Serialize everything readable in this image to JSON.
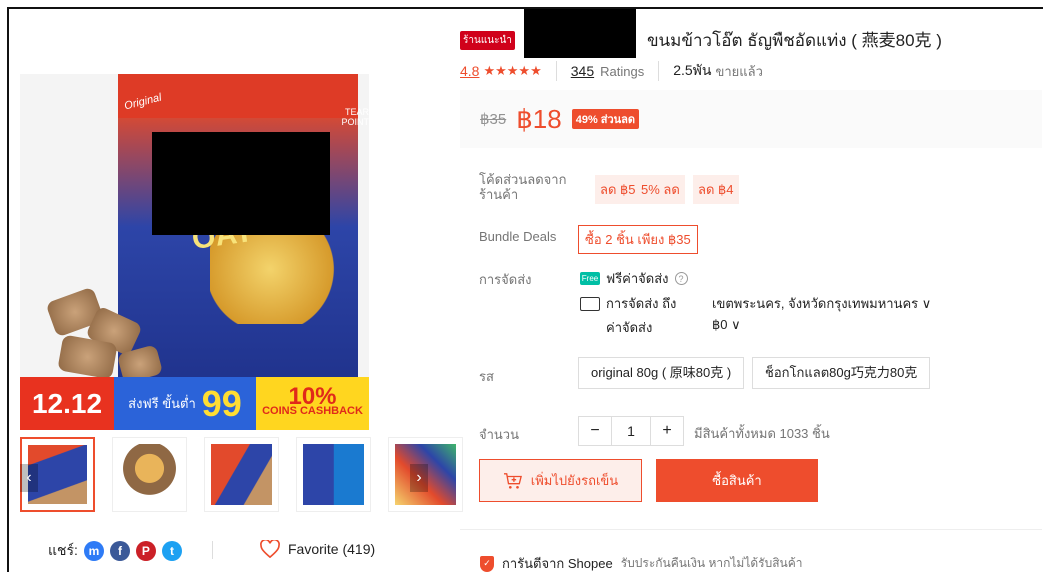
{
  "product": {
    "badge": "ร้านแนะนำ",
    "title": "ขนมข้าวโอ๊ต ธัญพืชอัดแท่ง ( 燕麦80克 )",
    "rating": "4.8",
    "stars": "★★★★★",
    "ratings_count": "345",
    "ratings_label": "Ratings",
    "sold_count": "2.5พัน",
    "sold_label": "ขายแล้ว",
    "old_price": "฿35",
    "price": "฿18",
    "discount": "49% ส่วนลด"
  },
  "image": {
    "pack_label": "Original",
    "tear_text": "TEAR POINT",
    "oat_text": "OAT",
    "promo_date": "12.12",
    "promo_ship": "ส่งฟรี ขั้นต่ำ",
    "promo_ship_amount": "99",
    "promo_cashback_pct": "10%",
    "promo_cashback_label": "COINS CASHBACK"
  },
  "arrows": {
    "prev": "‹",
    "next": "›"
  },
  "coupons": {
    "label": "โค้ดส่วนลดจากร้านค้า",
    "chips": [
      "ลด ฿5",
      "5% ลด",
      "ลด ฿4"
    ]
  },
  "bundle": {
    "label": "Bundle Deals",
    "value": "ซื้อ 2 ชิ้น เพียง ฿35"
  },
  "shipping": {
    "label": "การจัดส่ง",
    "free_badge": "Free",
    "free_text": "ฟรีค่าจัดส่ง",
    "help": "?",
    "to_label": "การจัดส่ง ถึง",
    "to_value": "เขตพระนคร, จังหวัดกรุงเทพมหานคร ∨",
    "fee_label": "ค่าจัดส่ง",
    "fee_value": "฿0 ∨"
  },
  "variants": {
    "label": "รส",
    "options": [
      "original 80g ( 原味80克 )",
      "ช็อกโกแลต80g巧克力80克"
    ]
  },
  "quantity": {
    "label": "จำนวน",
    "minus": "−",
    "value": "1",
    "plus": "+",
    "stock": "มีสินค้าทั้งหมด 1033 ชิ้น"
  },
  "actions": {
    "add_to_cart": "เพิ่มไปยังรถเข็น",
    "buy_now": "ซื้อสินค้า"
  },
  "share": {
    "label": "แชร์:",
    "favorite": "Favorite (419)",
    "icons": {
      "messenger": "m",
      "facebook": "f",
      "pinterest": "P",
      "twitter": "t"
    }
  },
  "guarantee": {
    "title": "การันตีจาก Shopee",
    "text": "รับประกันคืนเงิน หากไม่ได้รับสินค้า"
  },
  "colors": {
    "accent": "#ee4d2d",
    "messenger": "#2e7bf6",
    "facebook": "#3b5998",
    "pinterest": "#cb2027",
    "twitter": "#1da1f2"
  }
}
